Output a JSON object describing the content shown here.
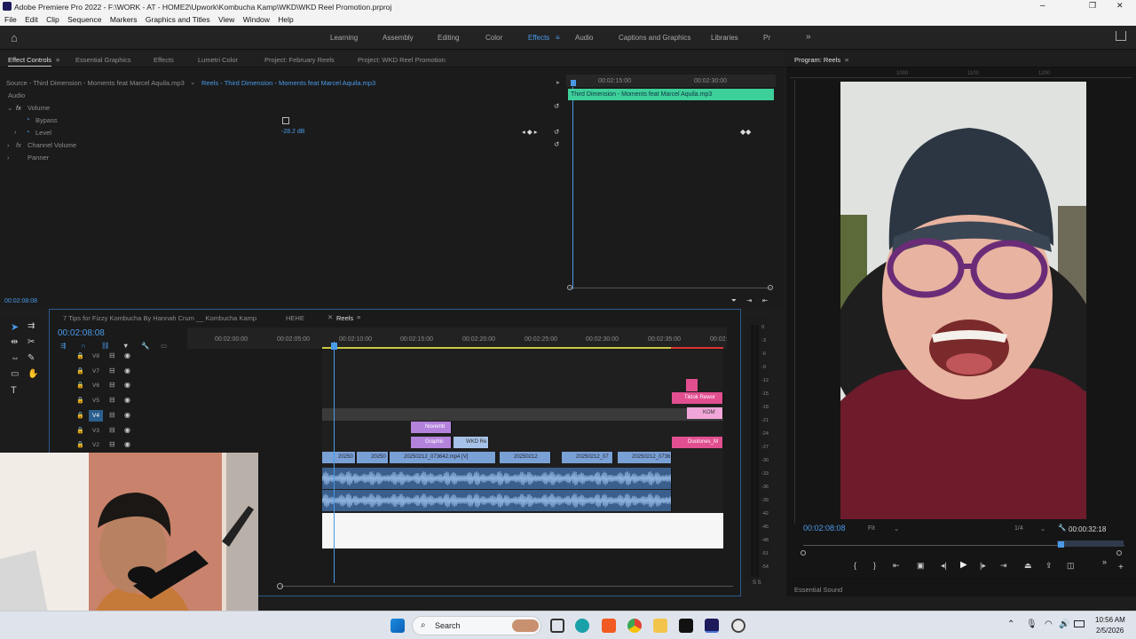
{
  "window": {
    "title": "Adobe Premiere Pro 2022 - F:\\WORK - AT - HOME2\\Upwork\\Kombucha Kamp\\WKD\\WKD Reel Promotion.prproj",
    "controls": [
      "–",
      "❐",
      "✕"
    ]
  },
  "menu": [
    "File",
    "Edit",
    "Clip",
    "Sequence",
    "Markers",
    "Graphics and Titles",
    "View",
    "Window",
    "Help"
  ],
  "workspaces": [
    "Learning",
    "Assembly",
    "Editing",
    "Color",
    "Effects",
    "Audio",
    "Captions and Graphics",
    "Libraries",
    "Pr"
  ],
  "active_workspace": "Effects",
  "top_panel_tabs": [
    "Effect Controls",
    "Essential Graphics",
    "Effects",
    "Lumetri Color",
    "Project: February Reels",
    "Project: WKD Reel Promotion"
  ],
  "effect_controls": {
    "source": "Source - Third Dimension - Moments feat Marcel Aquila.mp3",
    "target": "Reels - Third Dimension - Moments feat Marcel Aquila.mp3",
    "section": "Audio",
    "volume": "Volume",
    "bypass": "Bypass",
    "level": "Level",
    "level_value": "-28.2 dB",
    "channel_volume": "Channel Volume",
    "panner": "Panner",
    "mini_times": [
      "00:02:15:00",
      "00:02:30:00"
    ],
    "mini_clip": "Third Dimension - Moments feat Marcel Aquila.mp3",
    "timecode": "00:02:08:08"
  },
  "program": {
    "tab": "Program: Reels",
    "timecode": "00:02:08:08",
    "fit": "Fit",
    "quality": "1/4",
    "duration": "00:00:32:18",
    "ruler": [
      "1000",
      "1100",
      "1200"
    ],
    "essential": "Essential Sound"
  },
  "timeline": {
    "tabs": [
      "7 Tips for Fizzy Kombucha By Hannah Crum __ Kombucha Kamp",
      "HEHE",
      "Reels"
    ],
    "timecode": "00:02:08:08",
    "ruler": [
      "00:02:00:00",
      "00:02:05:00",
      "00:02:10:00",
      "00:02:15:00",
      "00:02:20:00",
      "00:02:25:00",
      "00:02:30:00",
      "00:02:35:00",
      "00:02:"
    ],
    "tracks": [
      "V8",
      "V7",
      "V6",
      "V5",
      "V4",
      "V3",
      "V2"
    ],
    "clips": {
      "tiktok": "Tiktok Rewor",
      "kom": "KOM",
      "novemb": "Novemb",
      "graphic": "Graphic",
      "wkdre": "WKD Re",
      "duotones": "Duotones_M",
      "v1": [
        "20250",
        "20250",
        "20250212_073642.mp4 [V]",
        "20250212",
        "20250212_07",
        "20250212_0736"
      ]
    }
  },
  "meter": [
    "0",
    "-3",
    "-6",
    "-9",
    "-12",
    "-15",
    "-18",
    "-21",
    "-24",
    "-27",
    "-30",
    "-33",
    "-36",
    "-39",
    "-42",
    "-45",
    "-48",
    "-51",
    "-54"
  ],
  "meter_ss": "S S",
  "taskbar": {
    "search": "Search",
    "time": "10:56 AM",
    "date": "2/5/2026"
  }
}
